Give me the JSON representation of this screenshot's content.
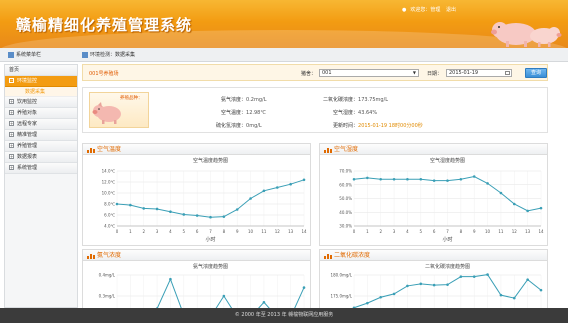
{
  "header": {
    "title": "赣榆精细化养殖管理系统",
    "user_welcome": "欢迎您：管理",
    "user_logout": "退出"
  },
  "subbar": {
    "menu_title": "系统菜单栏",
    "breadcrumb": "环境检测：数据采集"
  },
  "sidebar": {
    "items": [
      {
        "label": "首页",
        "active": false
      },
      {
        "label": "环境监控",
        "active": true
      },
      {
        "label": "数据采集",
        "sub": true
      },
      {
        "label": "饮用监控",
        "active": false
      },
      {
        "label": "养殖对象",
        "active": false
      },
      {
        "label": "远程专家",
        "active": false
      },
      {
        "label": "精准管理",
        "active": false
      },
      {
        "label": "养殖管理",
        "active": false
      },
      {
        "label": "数据报表",
        "active": false
      },
      {
        "label": "系统管理",
        "active": false
      }
    ]
  },
  "filter": {
    "farm": "001号养殖场",
    "house_label": "猪舍：",
    "house_value": "001",
    "date_label": "日期：",
    "date_value": "2015-01-19",
    "query_button": "查询"
  },
  "info": {
    "pig_label": "养殖品种：",
    "ammonia_label": "氨气浓度：",
    "ammonia_value": "0.2mg/L",
    "co2_label": "二氧化碳浓度：",
    "co2_value": "173.75mg/L",
    "air_temp_label": "空气温度：",
    "air_temp_value": "12.98℃",
    "air_hum_label": "空气湿度：",
    "air_hum_value": "43.64%",
    "h2s_label": "硫化氢浓度：",
    "h2s_value": "0mg/L",
    "update_label": "更新时间：",
    "update_value": "2015-01-19 18时00分00秒"
  },
  "charts": {
    "temp_panel": "空气温度",
    "hum_panel": "空气湿度",
    "nh3_panel": "氨气浓度",
    "co2_panel": "二氧化碳浓度"
  },
  "chart_data": [
    {
      "type": "line",
      "title": "空气温度趋势图",
      "xlabel": "小时",
      "x": [
        0,
        1,
        2,
        3,
        4,
        5,
        6,
        7,
        8,
        9,
        10,
        11,
        12,
        13,
        14
      ],
      "values": [
        8.0,
        7.8,
        7.2,
        7.1,
        6.6,
        6.1,
        5.9,
        5.6,
        5.7,
        7.0,
        9.0,
        10.4,
        11.0,
        11.6,
        12.4
      ],
      "yticks": [
        "4.0℃",
        "6.0℃",
        "8.0℃",
        "10.0℃",
        "12.0℃",
        "14.0℃"
      ],
      "ylim": [
        4,
        14
      ],
      "color": "#3a9fb6",
      "grid": true
    },
    {
      "type": "line",
      "title": "空气湿度趋势图",
      "xlabel": "小时",
      "x": [
        0,
        1,
        2,
        3,
        4,
        5,
        6,
        7,
        8,
        9,
        10,
        11,
        12,
        13,
        14
      ],
      "values": [
        64,
        65,
        64,
        64,
        64,
        64,
        63,
        63,
        64,
        66,
        61,
        54,
        46,
        41,
        43
      ],
      "yticks": [
        "30.0%",
        "40.0%",
        "50.0%",
        "60.0%",
        "70.0%"
      ],
      "ylim": [
        30,
        70
      ],
      "color": "#3a9fb6",
      "grid": true
    },
    {
      "type": "line",
      "title": "氨气浓度趋势图",
      "xlabel": "小时",
      "x": [
        0,
        1,
        2,
        3,
        4,
        5,
        6,
        7,
        8,
        9,
        10,
        11,
        12,
        13,
        14
      ],
      "values": [
        0.2,
        0.2,
        0.2,
        0.24,
        0.38,
        0.21,
        0.2,
        0.2,
        0.3,
        0.2,
        0.2,
        0.27,
        0.2,
        0.2,
        0.34
      ],
      "yticks": [
        "0.2mg/L",
        "0.3mg/L",
        "0.4mg/L"
      ],
      "ylim": [
        0.2,
        0.4
      ],
      "color": "#3a9fb6",
      "grid": true
    },
    {
      "type": "line",
      "title": "二氧化碳浓度趋势图",
      "xlabel": "小时",
      "x": [
        0,
        1,
        2,
        3,
        4,
        5,
        6,
        7,
        8,
        9,
        10,
        11,
        12,
        13,
        14
      ],
      "values": [
        172.2,
        173.3,
        174.7,
        175.5,
        177.4,
        177.9,
        177.6,
        177.7,
        179.6,
        179.6,
        180.1,
        175.2,
        174.5,
        178.9,
        176.4
      ],
      "yticks": [
        "170.0mg/L",
        "175.0mg/L",
        "180.0mg/L"
      ],
      "ylim": [
        170,
        180
      ],
      "color": "#3a9fb6",
      "grid": true
    }
  ],
  "footer": {
    "text": "© 2000 年至 2013 年 赣榆物联网应用服务"
  }
}
